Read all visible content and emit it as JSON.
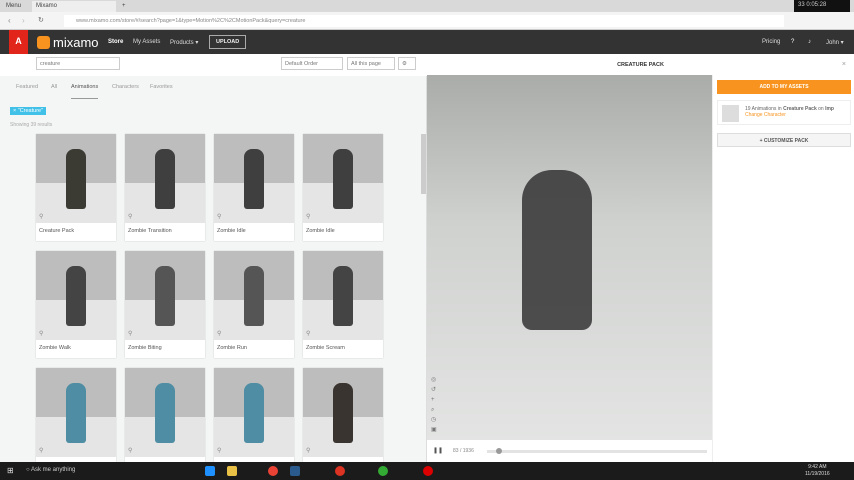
{
  "browser": {
    "tabs": [
      "Menu",
      "Mixamo"
    ],
    "url": "www.mixamo.com/store/#/search?page=1&type=Motion%2C%2CMotionPack&query=creature",
    "recorder": "33  0:05:28"
  },
  "nav": {
    "brand": "Adobe",
    "logo": "mixamo",
    "items": [
      "Store",
      "My Assets",
      "Products ▾"
    ],
    "upload": "UPLOAD",
    "pricing": "Pricing",
    "user": "John ▾"
  },
  "search": {
    "value": "creature",
    "order": "Default Order",
    "perpage": "All this page"
  },
  "filters": {
    "tabs": [
      "Featured",
      "All",
      "Animations",
      "Characters",
      "Favorites"
    ],
    "active": 2,
    "chip": "× \"Creature\"",
    "showing": "Showing 39 results"
  },
  "cards": [
    {
      "label": "Creature Pack",
      "color": "#3b3b33"
    },
    {
      "label": "Zombie Transition",
      "color": "#3f3f3f"
    },
    {
      "label": "Zombie Idle",
      "color": "#3f3f3f"
    },
    {
      "label": "Zombie Idle",
      "color": "#3f3f3f"
    },
    {
      "label": "Zombie Walk",
      "color": "#444"
    },
    {
      "label": "Zombie Biting",
      "color": "#555"
    },
    {
      "label": "Zombie Run",
      "color": "#555"
    },
    {
      "label": "Zombie Scream",
      "color": "#444"
    },
    {
      "label": "",
      "color": "#4e8da3"
    },
    {
      "label": "",
      "color": "#4e8da3"
    },
    {
      "label": "",
      "color": "#4e8da3"
    },
    {
      "label": "",
      "color": "#3a3430"
    }
  ],
  "panel": {
    "title": "CREATURE PACK",
    "add": "ADD TO MY ASSETS",
    "info_count": "19 Animations in",
    "info_pack": "Creature Pack",
    "info_on": "on",
    "info_char": "Imp",
    "change": "Change Character",
    "customize": "+ CUSTOMIZE PACK",
    "frame": "83 / 1936",
    "progress": 0.04
  },
  "taskbar": {
    "search": "Ask me anything",
    "time": "9:42 AM",
    "date": "11/19/2016"
  }
}
